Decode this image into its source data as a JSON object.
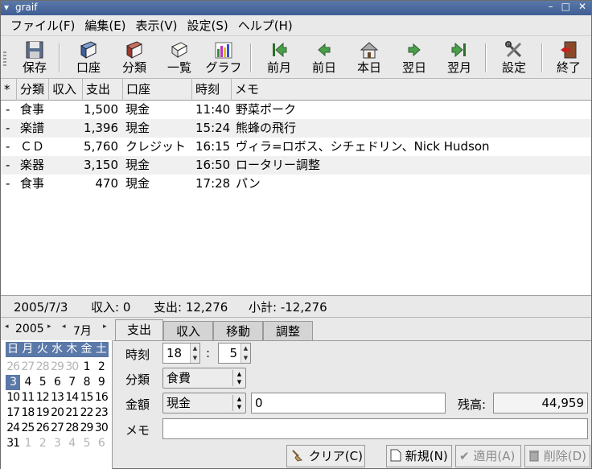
{
  "window": {
    "title": "graif"
  },
  "menu": [
    "ファイル(F)",
    "編集(E)",
    "表示(V)",
    "設定(S)",
    "ヘルプ(H)"
  ],
  "toolbar": {
    "save": "保存",
    "account": "口座",
    "category": "分類",
    "list": "一覧",
    "graph": "グラフ",
    "prev_month": "前月",
    "prev_day": "前日",
    "today": "本日",
    "next_day": "翌日",
    "next_month": "翌月",
    "settings": "設定",
    "quit": "終了"
  },
  "table": {
    "columns": [
      "*",
      "分類",
      "収入",
      "支出",
      "口座",
      "時刻",
      "メモ"
    ],
    "rows": [
      {
        "mark": "-",
        "category": "食事",
        "income": "",
        "expense": "1,500",
        "account": "現金",
        "time": "11:40",
        "memo": "野菜ポーク"
      },
      {
        "mark": "-",
        "category": "楽譜",
        "income": "",
        "expense": "1,396",
        "account": "現金",
        "time": "15:24",
        "memo": "熊蜂の飛行"
      },
      {
        "mark": "-",
        "category": "ＣＤ",
        "income": "",
        "expense": "5,760",
        "account": "クレジット",
        "time": "16:15",
        "memo": "ヴィラ=ロボス、シチェドリン、Nick Hudson"
      },
      {
        "mark": "-",
        "category": "楽器",
        "income": "",
        "expense": "3,150",
        "account": "現金",
        "time": "16:50",
        "memo": "ロータリー調整"
      },
      {
        "mark": "-",
        "category": "食事",
        "income": "",
        "expense": "470",
        "account": "現金",
        "time": "17:28",
        "memo": "パン"
      }
    ]
  },
  "status": {
    "date": "2005/7/3",
    "income": "収入: 0",
    "expense": "支出: 12,276",
    "subtotal": "小計: -12,276"
  },
  "calendar": {
    "year": "2005",
    "month": "7月",
    "weekdays": [
      "日",
      "月",
      "火",
      "水",
      "木",
      "金",
      "土"
    ],
    "weeks": [
      [
        "26",
        "27",
        "28",
        "29",
        "30",
        "1",
        "2"
      ],
      [
        "3",
        "4",
        "5",
        "6",
        "7",
        "8",
        "9"
      ],
      [
        "10",
        "11",
        "12",
        "13",
        "14",
        "15",
        "16"
      ],
      [
        "17",
        "18",
        "19",
        "20",
        "21",
        "22",
        "23"
      ],
      [
        "24",
        "25",
        "26",
        "27",
        "28",
        "29",
        "30"
      ],
      [
        "31",
        "1",
        "2",
        "3",
        "4",
        "5",
        "6"
      ]
    ]
  },
  "form": {
    "tabs": [
      "支出",
      "収入",
      "移動",
      "調整"
    ],
    "time_label": "時刻",
    "hour": "18",
    "time_sep": ":",
    "minute": "5",
    "category_label": "分類",
    "category": "食費",
    "amount_label": "金額",
    "account": "現金",
    "amount": "0",
    "balance_label": "残高:",
    "balance": "44,959",
    "memo_label": "メモ",
    "memo": ""
  },
  "buttons": {
    "clear": "クリア(C)",
    "new": "新規(N)",
    "apply": "適用(A)",
    "delete": "削除(D)"
  }
}
